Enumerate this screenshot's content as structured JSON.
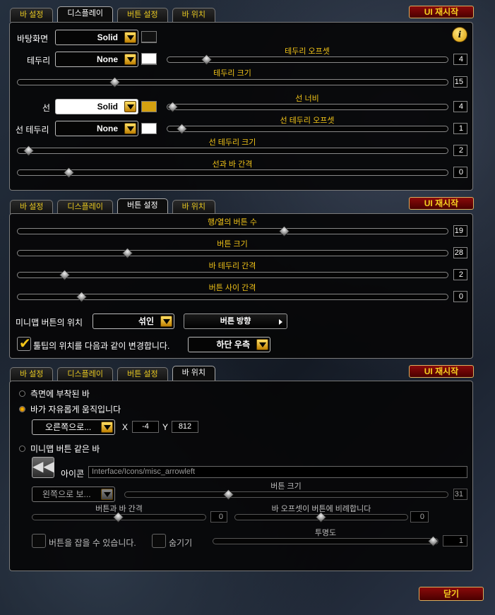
{
  "reset_label": "UI 재시작",
  "close_label": "닫기",
  "tabs": [
    "바 설정",
    "디스플레이",
    "버튼 설정",
    "바 위치"
  ],
  "p1": {
    "background_label": "바탕화면",
    "background_value": "Solid",
    "border_label": "테두리",
    "border_value": "None",
    "border_offset_label": "테두리 오프셋",
    "border_offset_value": "4",
    "border_size_label": "테두리 크기",
    "border_size_value": "15",
    "line_label": "선",
    "line_value": "Solid",
    "line_width_label": "선 너비",
    "line_width_value": "4",
    "line_border_label": "선 테두리",
    "line_border_value": "None",
    "line_border_offset_label": "선 테두리 오프셋",
    "line_border_offset_value": "1",
    "line_border_size_label": "선 테두리 크기",
    "line_border_size_value": "2",
    "line_bar_gap_label": "선과 바 간격",
    "line_bar_gap_value": "0",
    "swatch_line_color": "#d4a010",
    "swatch_white": "#ffffff",
    "swatch_empty": "#111111"
  },
  "p2": {
    "buttons_per_row_label": "행/열의 버튼 수",
    "buttons_per_row_value": "19",
    "button_size_label": "버튼 크기",
    "button_size_value": "28",
    "bar_border_gap_label": "바 테두리 간격",
    "bar_border_gap_value": "2",
    "button_gap_label": "버튼 사이 간격",
    "button_gap_value": "0",
    "minimap_pos_label": "미니맵 버튼의 위치",
    "minimap_pos_value": "섞인",
    "button_direction_label": "버튼 방향",
    "tooltip_label": "툴팁의 위치를 다음과 같이 변경합니다.",
    "tooltip_value": "하단 우측"
  },
  "p3": {
    "opt_attached": "측면에 부착된 바",
    "opt_free": "바가 자유롭게 움직입니다",
    "anchor_value": "오른쪽으로...",
    "x_label": "X",
    "x_value": "-4",
    "y_label": "Y",
    "y_value": "812",
    "opt_minimap": "미니맵 버튼 같은 바",
    "icon_label": "아이콘",
    "icon_path": "Interface/Icons/misc_arrowleft",
    "direction_value": "왼쪽으로 보...",
    "button_size_label": "버튼 크기",
    "button_size_value": "31",
    "bar_gap_label": "버튼과 바 간격",
    "bar_gap_value": "0",
    "bar_offset_label": "바 오프셋이 버튼에 비례합니다",
    "bar_offset_value": "0",
    "grab_label": "버튼을 잡을 수 있습니다.",
    "hide_label": "숨기기",
    "alpha_label": "투명도",
    "alpha_value": "1"
  }
}
